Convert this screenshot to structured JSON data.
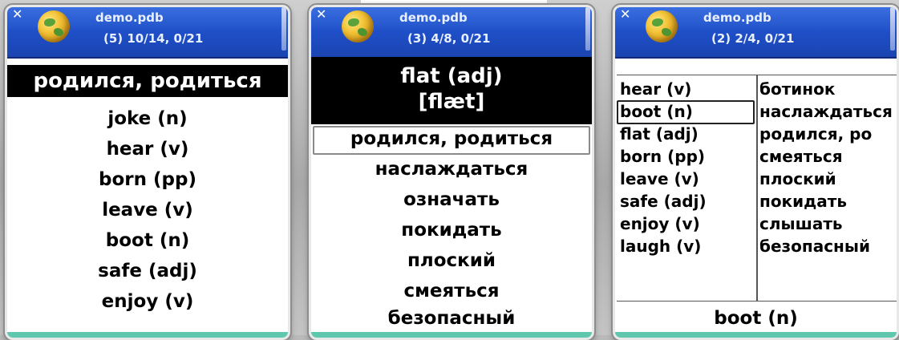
{
  "screens": [
    {
      "title": "demo.pdb",
      "status": "(5) 10/14, 0/21",
      "prompt": "родился, родиться",
      "items": [
        "joke (n)",
        "hear (v)",
        "born (pp)",
        "leave (v)",
        "boot (n)",
        "safe (adj)",
        "enjoy (v)"
      ]
    },
    {
      "title": "demo.pdb",
      "status": "(3) 4/8, 0/21",
      "prompt_word": "flat (adj)",
      "prompt_ipa": "[flæt]",
      "items": [
        "родился, родиться",
        "наслаждаться",
        "означать",
        "покидать",
        "плоский",
        "смеяться",
        "безопасный"
      ]
    },
    {
      "title": "demo.pdb",
      "status": "(2) 2/4, 0/21",
      "left": [
        "hear (v)",
        "boot (n)",
        "flat (adj)",
        "born (pp)",
        "leave (v)",
        "safe (adj)",
        "enjoy (v)",
        "laugh (v)"
      ],
      "right": [
        "ботинок",
        "наслаждаться",
        "родился, ро",
        "смеяться",
        "плоский",
        "покидать",
        "слышать",
        "безопасный"
      ],
      "footer": "boot (n)"
    }
  ],
  "icons": {
    "close": "close-icon",
    "app": "globe-icon"
  },
  "colors": {
    "header": "#1f4fc8",
    "accent": "#5fc7ae",
    "band": "#000000"
  }
}
